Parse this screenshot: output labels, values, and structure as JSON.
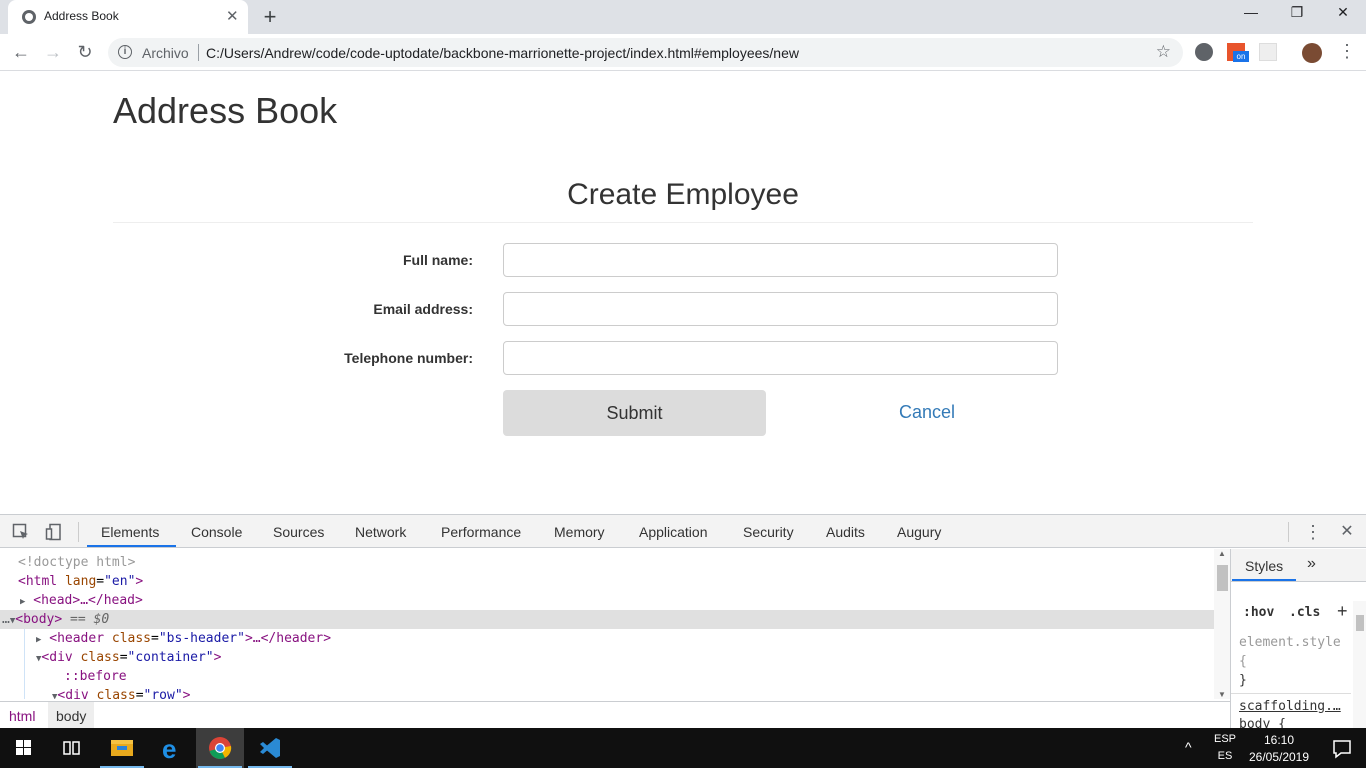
{
  "browser": {
    "tab_title": "Address Book",
    "tab_close": "✕",
    "new_tab": "+",
    "window_controls": {
      "minimize": "—",
      "restore": "❐",
      "close": "✕"
    },
    "address_scheme": "Archivo",
    "address_url": "C:/Users/Andrew/code/code-uptodate/backbone-marrionette-project/index.html#employees/new",
    "nav": {
      "back": "←",
      "forward": "→",
      "reload": "↻"
    },
    "extension_badge": "on"
  },
  "page": {
    "heading": "Address Book",
    "form": {
      "title": "Create Employee",
      "fields": [
        {
          "label": "Full name:",
          "value": ""
        },
        {
          "label": "Email address:",
          "value": ""
        },
        {
          "label": "Telephone number:",
          "value": ""
        }
      ],
      "submit_label": "Submit",
      "cancel_label": "Cancel"
    }
  },
  "devtools": {
    "tabs": [
      "Elements",
      "Console",
      "Sources",
      "Network",
      "Performance",
      "Memory",
      "Application",
      "Security",
      "Audits",
      "Augury"
    ],
    "active_tab": "Elements",
    "dom_lines": {
      "l1": "<!doctype html>",
      "l2_tag": "<html",
      "l2_attr": " lang",
      "l2_val": "\"en\"",
      "l2_end": ">",
      "l3": "<head>…</head>",
      "l4_tag": "<body>",
      "l4_eq": " == $0",
      "l5_tag": "<header",
      "l5_attr": " class",
      "l5_val": "\"bs-header\"",
      "l5_end": ">…</header>",
      "l6_tag": "<div",
      "l6_attr": " class",
      "l6_val": "\"container\"",
      "l6_end": ">",
      "l7": "::before",
      "l8_tag": "<div",
      "l8_attr": " class",
      "l8_val": "\"row\"",
      "l8_end": ">"
    },
    "breadcrumbs": [
      "html",
      "body"
    ],
    "styles": {
      "tab": "Styles",
      "more": "»",
      "hov": ":hov",
      "cls": ".cls",
      "add": "+",
      "rule1_selector": "element.style {",
      "rule1_close": "}",
      "rule2_source": "scaffolding.…",
      "rule2_selector": "body {"
    }
  },
  "taskbar": {
    "lang_top": "ESP",
    "lang_bottom": "ES",
    "time": "16:10",
    "date": "26/05/2019",
    "tray_arrow": "^"
  }
}
